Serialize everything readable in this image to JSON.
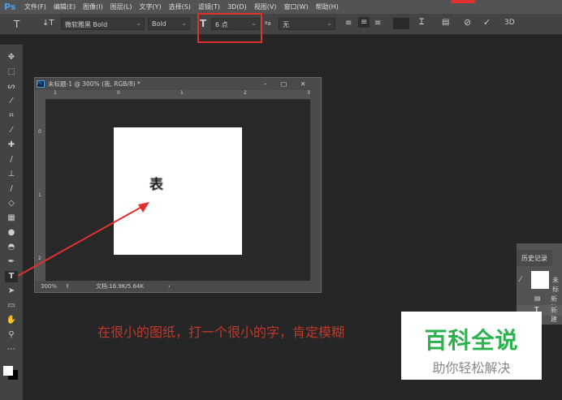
{
  "menubar": {
    "logo": "Ps",
    "items": [
      "文件(F)",
      "编辑(E)",
      "图像(I)",
      "图层(L)",
      "文字(Y)",
      "选择(S)",
      "滤镜(T)",
      "3D(D)",
      "视图(V)",
      "窗口(W)",
      "帮助(H)"
    ]
  },
  "options": {
    "font_family": "微软雅黑 Bold",
    "font_style": "Bold",
    "font_size": "6 点",
    "antialias": "无",
    "three_d": "3D"
  },
  "document": {
    "title": "未标题-1 @ 300% (我, RGB/8) *",
    "ruler_h": [
      "1",
      "0",
      "1",
      "2",
      "3"
    ],
    "ruler_v": [
      "0",
      "1",
      "2"
    ],
    "canvas_text": "表",
    "zoom": "300%",
    "doc_info": "文档:16.9K/5.64K"
  },
  "history": {
    "tab": "历史记录",
    "snapshot": "未标",
    "items": [
      "新建",
      "新建"
    ]
  },
  "annotation": {
    "text": "在很小的图纸，打一个很小的字，肯定模糊",
    "color": "#c83a3a",
    "highlight_color": "#e03030"
  },
  "watermark": {
    "title": "百科全说",
    "subtitle": "助你轻松解决",
    "color": "#2bb24c"
  }
}
